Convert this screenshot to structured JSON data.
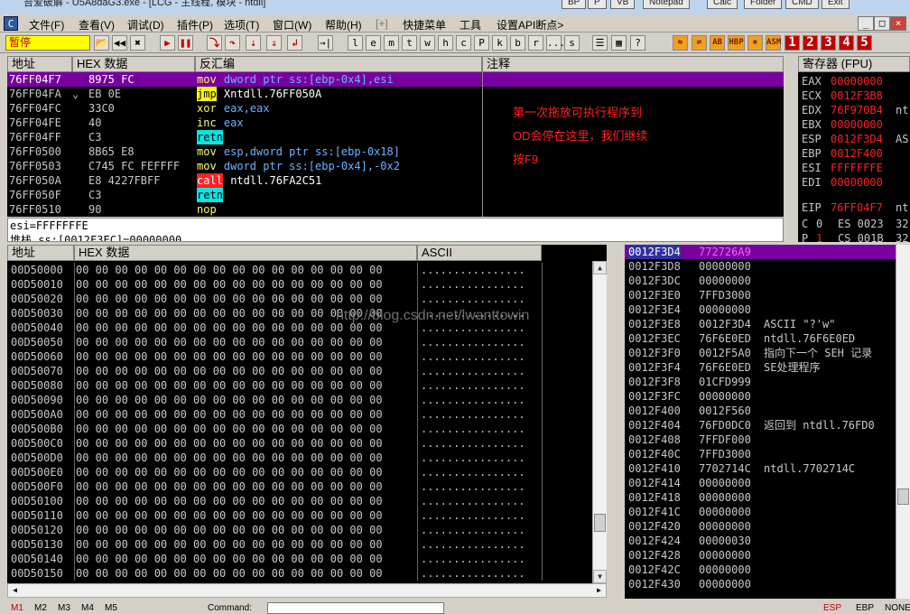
{
  "title": {
    "text": "吾爱破解 - U5A8daG3.exe - [LCG - 主线程, 模块 - ntdll]",
    "ext_buttons": [
      "BP",
      "P",
      "VB",
      "Notepad",
      "Calc",
      "Folder",
      "CMD",
      "Exit"
    ]
  },
  "menu": {
    "icon": "C",
    "items": [
      "文件(F)",
      "查看(V)",
      "调试(D)",
      "插件(P)",
      "选项(T)",
      "窗口(W)",
      "帮助(H)",
      "[+]",
      "快捷菜单",
      "工具",
      "设置API断点>"
    ],
    "win_buttons": [
      "_",
      "□",
      "×"
    ]
  },
  "toolbar": {
    "status": "暂停",
    "letters": [
      "l",
      "e",
      "m",
      "t",
      "w",
      "h",
      "c",
      "P",
      "k",
      "b",
      "r",
      "...",
      "s"
    ],
    "numbers": [
      "1",
      "2",
      "3",
      "4",
      "5"
    ],
    "orange": [
      "HBP",
      "ASM"
    ]
  },
  "disasm": {
    "headers": {
      "addr": "地址",
      "hex": "HEX 数据",
      "asm": "反汇编",
      "comment": "注释"
    },
    "rows": [
      {
        "addr": "76FF04F7",
        "hex": "8975 FC",
        "m": "mov",
        "ops": "dword ptr ss:[ebp-0x4],esi",
        "sel": true,
        "hl": ""
      },
      {
        "addr": "76FF04FA",
        "hex": "EB 0E",
        "m": "jmp",
        "ops": "Xntdll.76FF050A",
        "sel": false,
        "hl": "jmp",
        "mark": "⌄"
      },
      {
        "addr": "76FF04FC",
        "hex": "33C0",
        "m": "xor",
        "ops": "eax,eax",
        "sel": false,
        "hl": ""
      },
      {
        "addr": "76FF04FE",
        "hex": "40",
        "m": "inc",
        "ops": "eax",
        "sel": false,
        "hl": ""
      },
      {
        "addr": "76FF04FF",
        "hex": "C3",
        "m": "retn",
        "ops": "",
        "sel": false,
        "hl": "ret"
      },
      {
        "addr": "76FF0500",
        "hex": "8B65 E8",
        "m": "mov",
        "ops": "esp,dword ptr ss:[ebp-0x18]",
        "sel": false,
        "hl": ""
      },
      {
        "addr": "76FF0503",
        "hex": "C745 FC FEFFFF",
        "m": "mov",
        "ops": "dword ptr ss:[ebp-0x4],-0x2",
        "sel": false,
        "hl": ""
      },
      {
        "addr": "76FF050A",
        "hex": "E8 4227FBFF",
        "m": "call",
        "ops": "ntdll.76FA2C51",
        "sel": false,
        "hl": "call"
      },
      {
        "addr": "76FF050F",
        "hex": "C3",
        "m": "retn",
        "ops": "",
        "sel": false,
        "hl": "ret"
      },
      {
        "addr": "76FF0510",
        "hex": "90",
        "m": "nop",
        "ops": "",
        "sel": false,
        "hl": ""
      }
    ],
    "note": [
      "第一次拖放可执行程序到",
      "OD会停在这里，我们继续",
      "按F9"
    ]
  },
  "info": {
    "line1": "esi=FFFFFFFE",
    "line2": "堆栈 ss:[0012F3EC]=00000000"
  },
  "registers": {
    "header": "寄存器 (FPU)",
    "rows": [
      {
        "name": "EAX",
        "val": "00000000",
        "extra": ""
      },
      {
        "name": "ECX",
        "val": "0012F3B8",
        "extra": ""
      },
      {
        "name": "EDX",
        "val": "76F970B4",
        "extra": "nt"
      },
      {
        "name": "EBX",
        "val": "00000000",
        "extra": ""
      },
      {
        "name": "ESP",
        "val": "0012F3D4",
        "extra": "AS"
      },
      {
        "name": "EBP",
        "val": "0012F400",
        "extra": ""
      },
      {
        "name": "ESI",
        "val": "FFFFFFFE",
        "extra": ""
      },
      {
        "name": "EDI",
        "val": "00000000",
        "extra": ""
      },
      {
        "name": "EIP",
        "val": "76FF04F7",
        "extra": "nt"
      }
    ],
    "flags": [
      {
        "f": "C",
        "v": "0",
        "seg": "ES 0023",
        "tail": "32"
      },
      {
        "f": "P",
        "v": "1",
        "seg": "CS 001B",
        "tail": "32"
      }
    ]
  },
  "dump": {
    "headers": {
      "addr": "地址",
      "hex": "HEX 数据",
      "ascii": "ASCII"
    },
    "hexbytes": "00 00 00 00 00 00 00 00 00 00 00 00 00 00 00 00",
    "ascii": "................",
    "addrs": [
      "00D50000",
      "00D50010",
      "00D50020",
      "00D50030",
      "00D50040",
      "00D50050",
      "00D50060",
      "00D50070",
      "00D50080",
      "00D50090",
      "00D500A0",
      "00D500B0",
      "00D500C0",
      "00D500D0",
      "00D500E0",
      "00D500F0",
      "00D50100",
      "00D50110",
      "00D50120",
      "00D50130",
      "00D50140",
      "00D50150"
    ]
  },
  "stack": {
    "rows": [
      {
        "addr": "0012F3D4",
        "val": "77272 6A9",
        "c": "",
        "sel": true
      },
      {
        "addr": "0012F3D8",
        "val": "00000000",
        "c": ""
      },
      {
        "addr": "0012F3DC",
        "val": "00000000",
        "c": ""
      },
      {
        "addr": "0012F3E0",
        "val": "7FFD3000",
        "c": ""
      },
      {
        "addr": "0012F3E4",
        "val": "00000000",
        "c": ""
      },
      {
        "addr": "0012F3E8",
        "val": "0012F3D4",
        "c": "ASCII \"?'w\""
      },
      {
        "addr": "0012F3EC",
        "val": "76F6E0ED",
        "c": "ntdll.76F6E0ED"
      },
      {
        "addr": "0012F3F0",
        "val": "0012F5A0",
        "c": "指向下一个 SEH 记录"
      },
      {
        "addr": "0012F3F4",
        "val": "76F6E0ED",
        "c": "SE处理程序"
      },
      {
        "addr": "0012F3F8",
        "val": "01CFD999",
        "c": ""
      },
      {
        "addr": "0012F3FC",
        "val": "00000000",
        "c": ""
      },
      {
        "addr": "0012F400",
        "val": "0012F560",
        "c": ""
      },
      {
        "addr": "0012F404",
        "val": "76FD0DC0",
        "c": "返回到 ntdll.76FD0"
      },
      {
        "addr": "0012F408",
        "val": "7FFDF000",
        "c": ""
      },
      {
        "addr": "0012F40C",
        "val": "7FFD3000",
        "c": ""
      },
      {
        "addr": "0012F410",
        "val": "7702714C",
        "c": "ntdll.7702714C"
      },
      {
        "addr": "0012F414",
        "val": "00000000",
        "c": ""
      },
      {
        "addr": "0012F418",
        "val": "00000000",
        "c": ""
      },
      {
        "addr": "0012F41C",
        "val": "00000000",
        "c": ""
      },
      {
        "addr": "0012F420",
        "val": "00000000",
        "c": ""
      },
      {
        "addr": "0012F424",
        "val": "00000030",
        "c": ""
      },
      {
        "addr": "0012F428",
        "val": "00000000",
        "c": ""
      },
      {
        "addr": "0012F42C",
        "val": "00000000",
        "c": ""
      },
      {
        "addr": "0012F430",
        "val": "00000000",
        "c": ""
      }
    ]
  },
  "watermark": "http://blog.csdn.net/lwanttowin",
  "bottom": {
    "marks": [
      "M1",
      "M2",
      "M3",
      "M4",
      "M5"
    ],
    "command_label": "Command:",
    "reg_labels": [
      "ESP",
      "EBP",
      "NONE"
    ]
  }
}
